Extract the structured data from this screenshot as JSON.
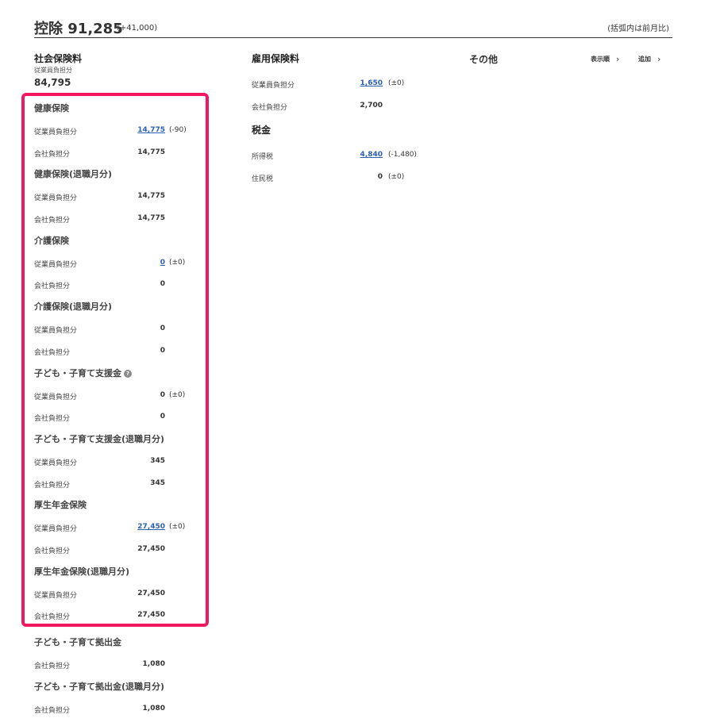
{
  "header": {
    "title": "控除 91,285",
    "diff": "(+41,000)",
    "note": "(括弧内は前月比)"
  },
  "social_insurance": {
    "title": "社会保険料",
    "sub_label": "従業員負担分",
    "total": "84,795",
    "groups": [
      {
        "title": "健康保険",
        "rows": [
          {
            "label": "従業員負担分",
            "value": "14,775",
            "diff": "(-90)",
            "link": true
          },
          {
            "label": "会社負担分",
            "value": "14,775",
            "diff": "",
            "link": false
          }
        ]
      },
      {
        "title": "健康保険(退職月分)",
        "rows": [
          {
            "label": "従業員負担分",
            "value": "14,775",
            "diff": "",
            "link": false
          },
          {
            "label": "会社負担分",
            "value": "14,775",
            "diff": "",
            "link": false
          }
        ]
      },
      {
        "title": "介護保険",
        "rows": [
          {
            "label": "従業員負担分",
            "value": "0",
            "diff": "(±0)",
            "link": true
          },
          {
            "label": "会社負担分",
            "value": "0",
            "diff": "",
            "link": false
          }
        ]
      },
      {
        "title": "介護保険(退職月分)",
        "rows": [
          {
            "label": "従業員負担分",
            "value": "0",
            "diff": "",
            "link": false
          },
          {
            "label": "会社負担分",
            "value": "0",
            "diff": "",
            "link": false
          }
        ]
      },
      {
        "title": "子ども・子育て支援金",
        "help_icon": "question-circle-icon",
        "rows": [
          {
            "label": "従業員負担分",
            "value": "0",
            "diff": "(±0)",
            "link": false
          },
          {
            "label": "会社負担分",
            "value": "0",
            "diff": "",
            "link": false
          }
        ]
      },
      {
        "title": "子ども・子育て支援金(退職月分)",
        "rows": [
          {
            "label": "従業員負担分",
            "value": "345",
            "diff": "",
            "link": false
          },
          {
            "label": "会社負担分",
            "value": "345",
            "diff": "",
            "link": false
          }
        ]
      },
      {
        "title": "厚生年金保険",
        "rows": [
          {
            "label": "従業員負担分",
            "value": "27,450",
            "diff": "(±0)",
            "link": true
          },
          {
            "label": "会社負担分",
            "value": "27,450",
            "diff": "",
            "link": false
          }
        ]
      },
      {
        "title": "厚生年金保険(退職月分)",
        "rows": [
          {
            "label": "従業員負担分",
            "value": "27,450",
            "diff": "",
            "link": false
          },
          {
            "label": "会社負担分",
            "value": "27,450",
            "diff": "",
            "link": false
          }
        ]
      }
    ],
    "after_groups": [
      {
        "title": "子ども・子育て拠出金",
        "rows": [
          {
            "label": "会社負担分",
            "value": "1,080",
            "diff": "",
            "link": false
          }
        ]
      },
      {
        "title": "子ども・子育て拠出金(退職月分)",
        "rows": [
          {
            "label": "会社負担分",
            "value": "1,080",
            "diff": "",
            "link": false
          }
        ]
      }
    ]
  },
  "employment_insurance": {
    "title": "雇用保険料",
    "rows": [
      {
        "label": "従業員負担分",
        "value": "1,650",
        "diff": "(±0)",
        "link": true
      },
      {
        "label": "会社負担分",
        "value": "2,700",
        "diff": "",
        "link": false
      }
    ]
  },
  "tax": {
    "title": "税金",
    "rows": [
      {
        "label": "所得税",
        "value": "4,840",
        "diff": "(-1,480)",
        "link": true
      },
      {
        "label": "住民税",
        "value": "0",
        "diff": "(±0)",
        "link": false
      }
    ]
  },
  "other": {
    "title": "その他",
    "display_order_label": "表示順",
    "add_label": "追加"
  },
  "colors": {
    "highlight": "#f0195f",
    "link": "#2b5fb4"
  }
}
